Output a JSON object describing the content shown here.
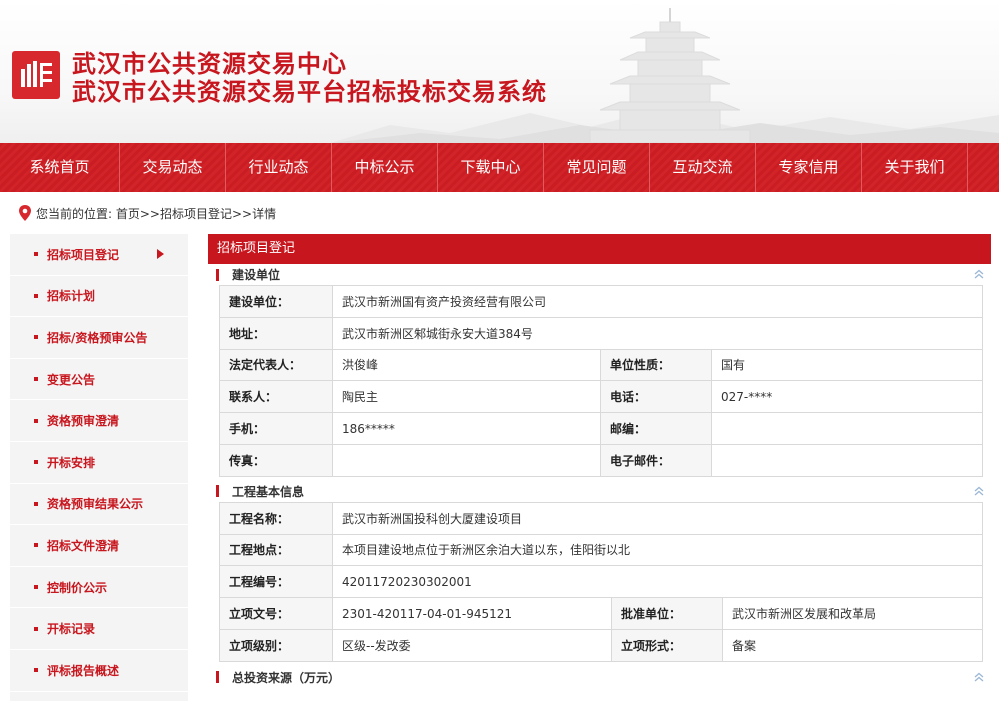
{
  "header": {
    "title_line1": "武汉市公共资源交易中心",
    "title_line2": "武汉市公共资源交易平台招标投标交易系统",
    "brand_color": "#c8161e"
  },
  "nav": {
    "items": [
      "系统首页",
      "交易动态",
      "行业动态",
      "中标公示",
      "下载中心",
      "常见问题",
      "互动交流",
      "专家信用",
      "关于我们"
    ]
  },
  "breadcrumb": {
    "text": "您当前的位置: 首页>>招标项目登记>>详情"
  },
  "sidebar": {
    "items": [
      "招标项目登记",
      "招标计划",
      "招标/资格预审公告",
      "变更公告",
      "资格预审澄清",
      "开标安排",
      "资格预审结果公示",
      "招标文件澄清",
      "控制价公示",
      "开标记录",
      "评标报告概述"
    ]
  },
  "main": {
    "title": "招标项目登记",
    "section1": {
      "title": "建设单位",
      "rows": {
        "unit_label": "建设单位：",
        "unit_value": "武汉市新洲国有资产投资经营有限公司",
        "address_label": "地址：",
        "address_value": "武汉市新洲区邾城街永安大道384号",
        "legal_label": "法定代表人：",
        "legal_value": "洪俊峰",
        "nature_label": "单位性质：",
        "nature_value": "国有",
        "contact_label": "联系人：",
        "contact_value": "陶民主",
        "phone_label": "电话：",
        "phone_value": "027-****",
        "mobile_label": "手机：",
        "mobile_value": "186*****",
        "postcode_label": "邮编：",
        "postcode_value": "",
        "fax_label": "传真：",
        "fax_value": "",
        "email_label": "电子邮件：",
        "email_value": ""
      }
    },
    "section2": {
      "title": "工程基本信息",
      "rows": {
        "name_label": "工程名称：",
        "name_value": "武汉市新洲国投科创大厦建设项目",
        "site_label": "工程地点：",
        "site_value": "本项目建设地点位于新洲区余泊大道以东，佳阳街以北",
        "code_label": "工程编号：",
        "code_value": "42011720230302001",
        "approval_label": "立项文号：",
        "approval_value": "2301-420117-04-01-945121",
        "approver_label": "批准单位：",
        "approver_value": "武汉市新洲区发展和改革局",
        "level_label": "立项级别：",
        "level_value": "区级--发改委",
        "form_label": "立项形式：",
        "form_value": "备案"
      }
    },
    "section3": {
      "title": "总投资来源（万元）"
    }
  }
}
